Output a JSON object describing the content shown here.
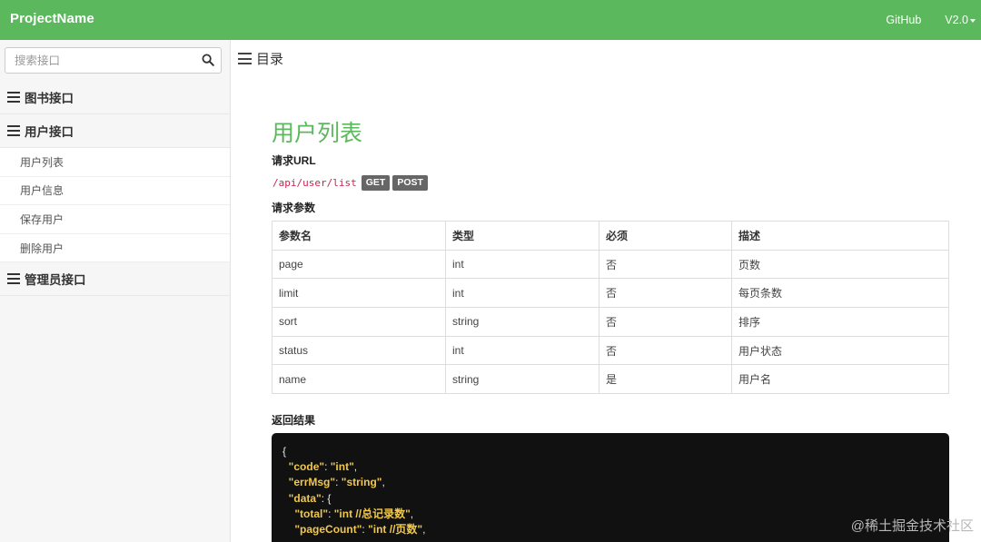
{
  "navbar": {
    "brand": "ProjectName",
    "links": [
      "GitHub",
      "V2.0"
    ]
  },
  "sidebar": {
    "search_placeholder": "搜索接口",
    "groups": [
      {
        "label": "图书接口",
        "items": []
      },
      {
        "label": "用户接口",
        "items": [
          "用户列表",
          "用户信息",
          "保存用户",
          "删除用户"
        ]
      },
      {
        "label": "管理员接口",
        "items": []
      }
    ]
  },
  "main": {
    "toc_label": "目录",
    "title": "用户列表",
    "request_url_label": "请求URL",
    "url": "/api/user/list",
    "methods": [
      "GET",
      "POST"
    ],
    "params_label": "请求参数",
    "params_table": {
      "headers": [
        "参数名",
        "类型",
        "必须",
        "描述"
      ],
      "rows": [
        [
          "page",
          "int",
          "否",
          "页数"
        ],
        [
          "limit",
          "int",
          "否",
          "每页条数"
        ],
        [
          "sort",
          "string",
          "否",
          "排序"
        ],
        [
          "status",
          "int",
          "否",
          "用户状态"
        ],
        [
          "name",
          "string",
          "是",
          "用户名"
        ]
      ]
    },
    "result_label": "返回结果",
    "code_lines": [
      {
        "indent": "",
        "key": "",
        "value": "",
        "text": "{"
      },
      {
        "indent": "  ",
        "key": "\"code\"",
        "value": "\"int\"",
        "text": ""
      },
      {
        "indent": "  ",
        "key": "\"errMsg\"",
        "value": "\"string\"",
        "text": ""
      },
      {
        "indent": "  ",
        "key": "\"data\"",
        "value": "",
        "text": "{"
      },
      {
        "indent": "    ",
        "key": "\"total\"",
        "value": "\"int //总记录数\"",
        "text": ""
      },
      {
        "indent": "    ",
        "key": "\"pageCount\"",
        "value": "\"int //页数\"",
        "text": ""
      }
    ]
  },
  "watermark": "@稀土掘金技术社区"
}
